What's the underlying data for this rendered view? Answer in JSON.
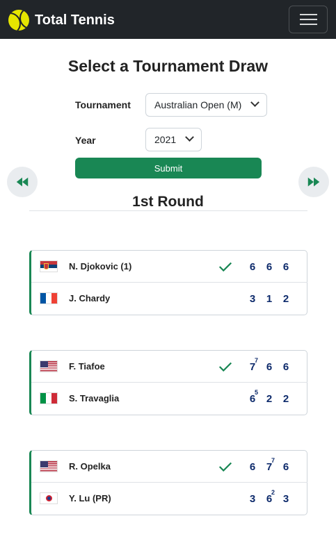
{
  "navbar": {
    "brand": "Total Tennis",
    "brand_icon": "tennis-ball-icon",
    "menu_icon": "hamburger-menu-icon"
  },
  "page": {
    "title": "Select a Tournament Draw"
  },
  "form": {
    "tournament_label": "Tournament",
    "tournament_value": "Australian Open (M)",
    "year_label": "Year",
    "year_value": "2021",
    "submit_label": "Submit"
  },
  "nav_buttons": {
    "prev_icon": "rewind-icon",
    "next_icon": "fast-forward-icon"
  },
  "round": {
    "title": "1st Round"
  },
  "colors": {
    "accent": "#198754",
    "score": "#0d2a6b",
    "navbar": "#212529"
  },
  "matches": [
    {
      "players": [
        {
          "name": "N. Djokovic (1)",
          "flag": "serbia-flag-icon",
          "winner": true,
          "scores": [
            "6",
            "6",
            "6"
          ],
          "tiebreaks": [
            "",
            "",
            ""
          ]
        },
        {
          "name": "J. Chardy",
          "flag": "france-flag-icon",
          "winner": false,
          "scores": [
            "3",
            "1",
            "2"
          ],
          "tiebreaks": [
            "",
            "",
            ""
          ]
        }
      ]
    },
    {
      "players": [
        {
          "name": "F. Tiafoe",
          "flag": "usa-flag-icon",
          "winner": true,
          "scores": [
            "7",
            "6",
            "6"
          ],
          "tiebreaks": [
            "7",
            "",
            ""
          ]
        },
        {
          "name": "S. Travaglia",
          "flag": "italy-flag-icon",
          "winner": false,
          "scores": [
            "6",
            "2",
            "2"
          ],
          "tiebreaks": [
            "5",
            "",
            ""
          ]
        }
      ]
    },
    {
      "players": [
        {
          "name": "R. Opelka",
          "flag": "usa-flag-icon",
          "winner": true,
          "scores": [
            "6",
            "7",
            "6"
          ],
          "tiebreaks": [
            "",
            "7",
            ""
          ]
        },
        {
          "name": "Y. Lu (PR)",
          "flag": "chinese-taipei-flag-icon",
          "winner": false,
          "scores": [
            "3",
            "6",
            "3"
          ],
          "tiebreaks": [
            "",
            "2",
            ""
          ]
        }
      ]
    }
  ]
}
